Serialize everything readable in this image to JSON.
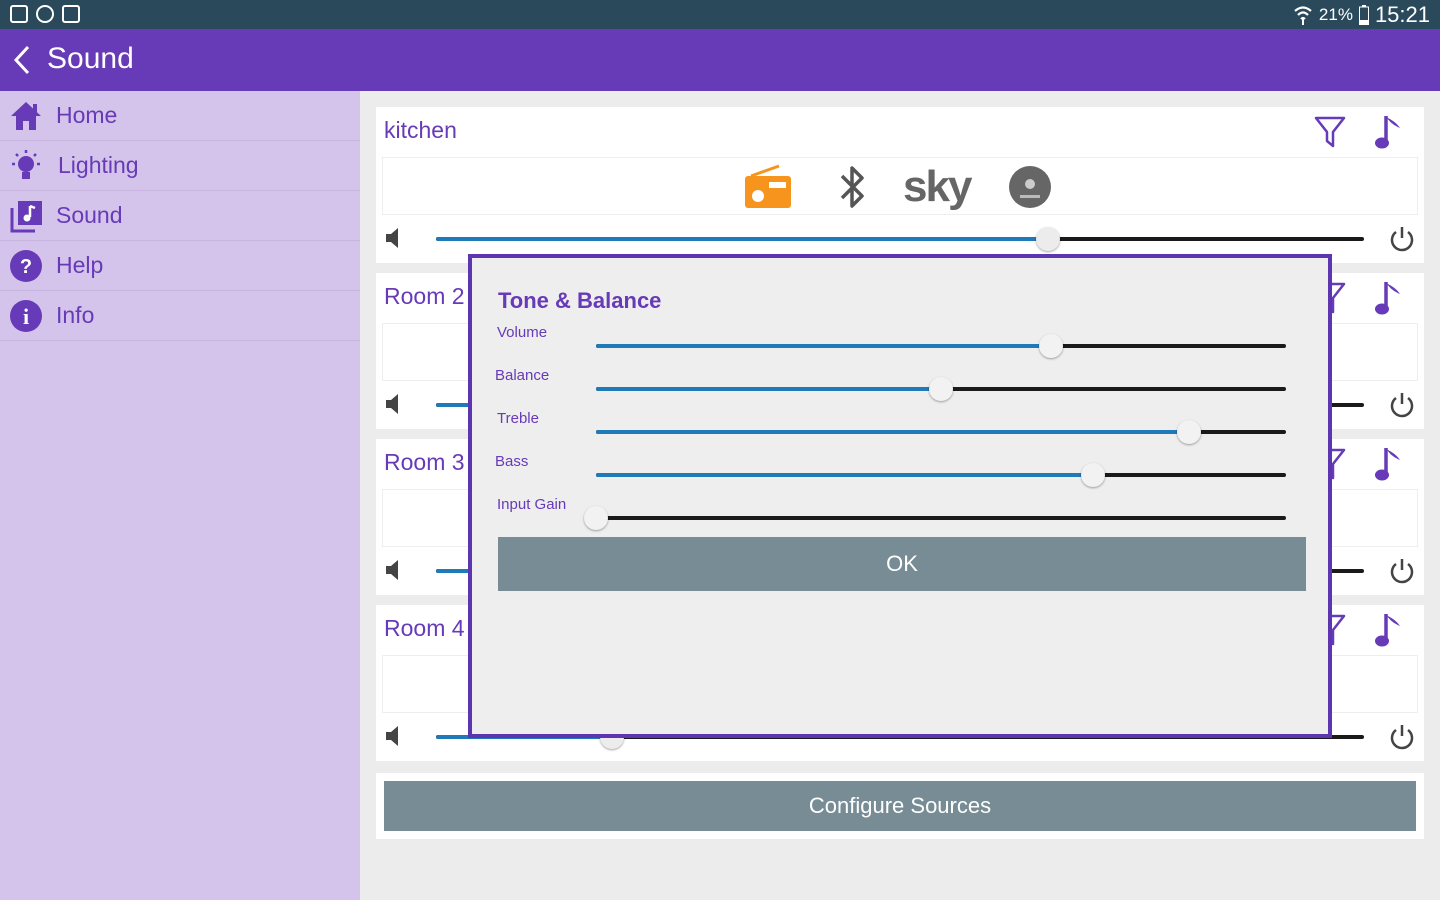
{
  "status_bar": {
    "left_icons": [
      "gallery-icon",
      "at-icon",
      "dropbox-icon"
    ],
    "battery": "21%",
    "time": "15:21"
  },
  "app_bar": {
    "title": "Sound"
  },
  "sidebar": {
    "items": [
      {
        "label": "Home",
        "icon": "home-icon"
      },
      {
        "label": "Lighting",
        "icon": "bulb-icon"
      },
      {
        "label": "Sound",
        "icon": "music-library-icon"
      },
      {
        "label": "Help",
        "icon": "help-icon"
      },
      {
        "label": "Info",
        "icon": "info-icon"
      }
    ]
  },
  "zones": [
    {
      "name": "kitchen",
      "volume": 0.66
    },
    {
      "name": "Room 2",
      "volume": 0.3
    },
    {
      "name": "Room 3",
      "volume": 0.3
    },
    {
      "name": "Room 4",
      "volume": 0.19
    }
  ],
  "sources": {
    "sky_label": "sky"
  },
  "configure_label": "Configure Sources",
  "dialog": {
    "title": "Tone & Balance",
    "sliders": [
      {
        "label": "Volume",
        "value": 0.66
      },
      {
        "label": "Balance",
        "value": 0.5
      },
      {
        "label": "Treble",
        "value": 0.86
      },
      {
        "label": "Bass",
        "value": 0.72
      },
      {
        "label": "Input Gain",
        "value": 0.0
      }
    ],
    "ok_label": "OK"
  },
  "colors": {
    "accent": "#673ab7",
    "status_bar": "#2a4a5c",
    "sidebar_bg": "#d4c3ea",
    "slider_fill": "#1f7ab8",
    "button_bg": "#778c94",
    "radio_orange": "#f7941d"
  }
}
